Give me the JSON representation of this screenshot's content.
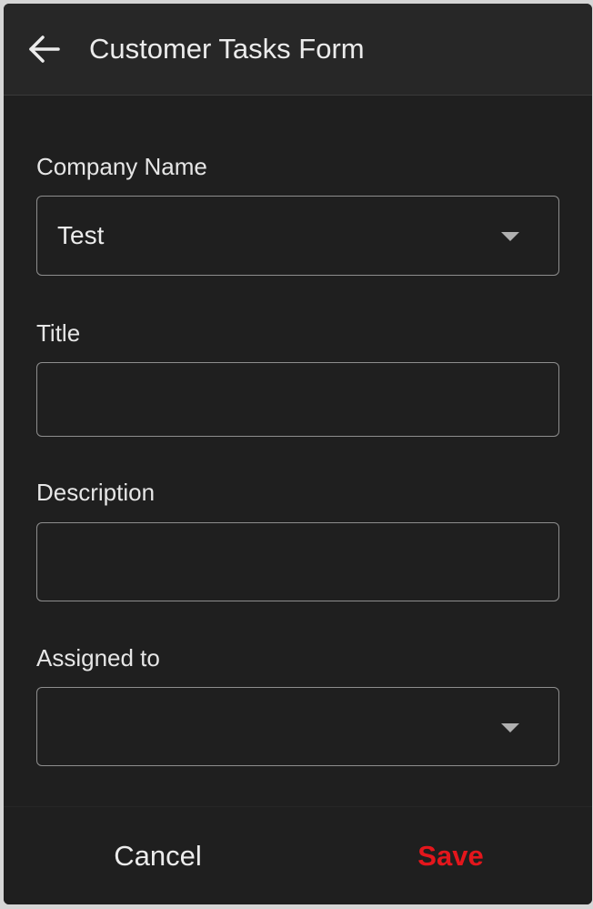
{
  "header": {
    "back_icon": "arrow-left-icon",
    "title": "Customer Tasks Form"
  },
  "form": {
    "company_name": {
      "label": "Company Name",
      "value": "Test",
      "icon": "caret-down-icon"
    },
    "title": {
      "label": "Title",
      "value": "",
      "placeholder": ""
    },
    "description": {
      "label": "Description",
      "value": "",
      "placeholder": ""
    },
    "assigned_to": {
      "label": "Assigned to",
      "value": "",
      "icon": "caret-down-icon"
    }
  },
  "footer": {
    "cancel_label": "Cancel",
    "save_label": "Save"
  },
  "colors": {
    "background": "#1f1f1f",
    "header_background": "#272727",
    "text": "#ececec",
    "border": "#8e8e8e",
    "save_accent": "#e4161c"
  }
}
